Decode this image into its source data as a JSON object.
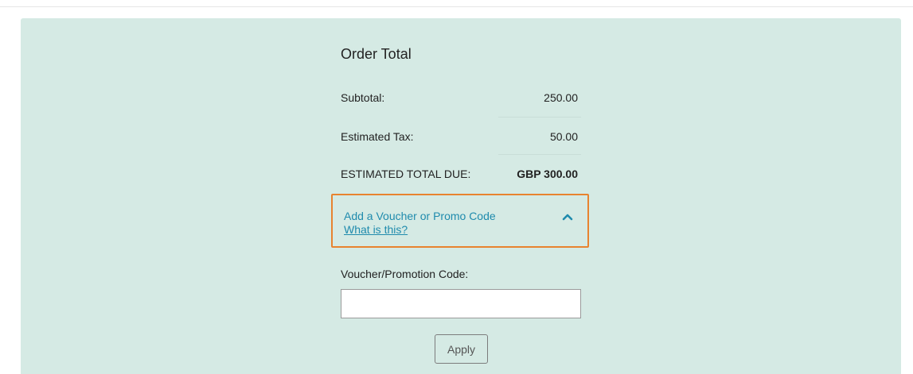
{
  "order": {
    "title": "Order Total",
    "subtotal_label": "Subtotal:",
    "subtotal_value": "250.00",
    "tax_label": "Estimated Tax:",
    "tax_value": "50.00",
    "total_label": "ESTIMATED TOTAL DUE:",
    "total_value": "GBP 300.00"
  },
  "voucher": {
    "toggle_label": "Add a Voucher or Promo Code",
    "help_link": "What is this?",
    "toggle_icon": "chevron-up-icon",
    "code_label": "Voucher/Promotion Code:",
    "code_value": "",
    "code_placeholder": "",
    "apply_label": "Apply"
  },
  "colors": {
    "panel_background": "#d5eae4",
    "link": "#1f8bad",
    "focus_outline": "#e8832f"
  }
}
